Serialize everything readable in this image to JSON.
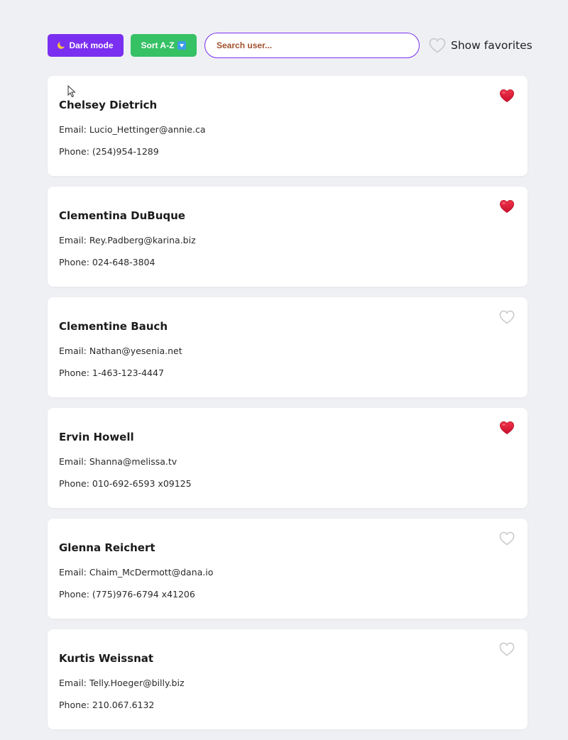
{
  "toolbar": {
    "dark_mode_label": "Dark mode",
    "dark_mode_icon": "crescent-moon-icon",
    "sort_label": "Sort A-Z",
    "sort_icon": "down-arrow-button-icon",
    "search_placeholder": "Search user...",
    "search_value": "",
    "show_favorites_label": "Show favorites",
    "show_favorites_icon": "heart-outline-icon",
    "show_favorites_active": false
  },
  "colors": {
    "dark_mode_button": "#7b2ff0",
    "sort_button": "#36c165",
    "search_border": "#7b2ff0",
    "search_placeholder": "#a0522d",
    "heart_filled": "#e0192f",
    "heart_outline": "#c8c8c8",
    "page_background": "#eff0f4",
    "card_background": "#ffffff"
  },
  "users": [
    {
      "name": "Chelsey Dietrich",
      "email": "Email: Lucio_Hettinger@annie.ca",
      "phone": "Phone: (254)954-1289",
      "favorite": true
    },
    {
      "name": "Clementina DuBuque",
      "email": "Email: Rey.Padberg@karina.biz",
      "phone": "Phone: 024-648-3804",
      "favorite": true
    },
    {
      "name": "Clementine Bauch",
      "email": "Email: Nathan@yesenia.net",
      "phone": "Phone: 1-463-123-4447",
      "favorite": false
    },
    {
      "name": "Ervin Howell",
      "email": "Email: Shanna@melissa.tv",
      "phone": "Phone: 010-692-6593 x09125",
      "favorite": true
    },
    {
      "name": "Glenna Reichert",
      "email": "Email: Chaim_McDermott@dana.io",
      "phone": "Phone: (775)976-6794 x41206",
      "favorite": false
    },
    {
      "name": "Kurtis Weissnat",
      "email": "Email: Telly.Hoeger@billy.biz",
      "phone": "Phone: 210.067.6132",
      "favorite": false
    }
  ]
}
